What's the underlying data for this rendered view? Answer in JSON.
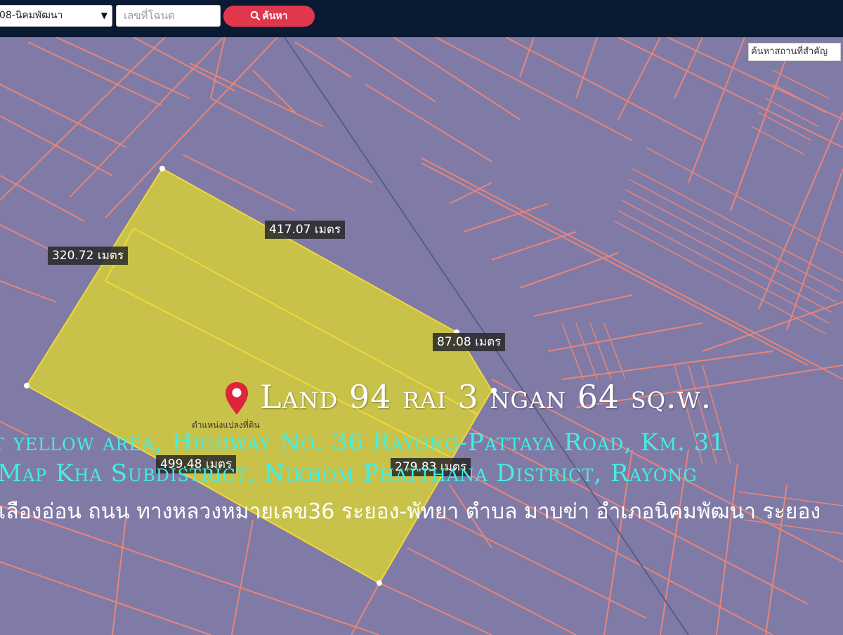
{
  "topbar": {
    "district_select": "08-นิคมพัฒนา",
    "deed_placeholder": "เลขที่โฉนด",
    "search_label": "ค้นหา"
  },
  "map": {
    "place_search_placeholder": "ค้นหาสถานที่สำคัญ",
    "dimensions": [
      "417.07 เมตร",
      "320.72 เมตร",
      "87.08 เมตร",
      "499.48 เมตร",
      "279.83 เมตร"
    ],
    "pin_label": "ตำแหน่งแปลงที่ดิน",
    "title": "Land 94 rai 3 ngan 64 sq.w.",
    "line1": "t yellow area, Highway No. 36 Rayong-Pattaya Road, Km. 31",
    "line2": "Map Kha Subdistrict, Nikhom Phatthana District, Rayong",
    "line3": "เลืองอ่อน ถนน ทางหลวงหมายเลข36 ระยอง-พัทยา ตำบล มาบข่า อำเภอนิคมพัฒนา ระยอง",
    "colors": {
      "background": "#7f7ba6",
      "parcel_lines": "#e8857a",
      "highlight_fill": "#c8c24a",
      "highlight_edge": "#f2d73a",
      "overlay_cyan": "#3ff0e6",
      "button": "#e0374c",
      "topbar": "#0b1a33"
    }
  }
}
